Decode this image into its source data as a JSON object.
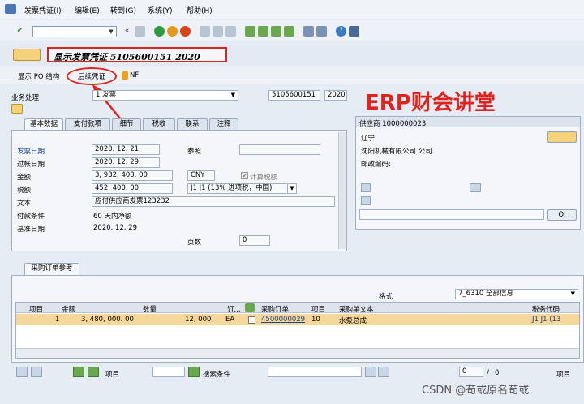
{
  "menu": [
    "发票凭证(I)",
    "编辑(E)",
    "转到(G)",
    "系统(Y)",
    "帮助(H)"
  ],
  "toolbar": {
    "enter_icon": "check-icon",
    "back_icon": "back-icon"
  },
  "title": "显示发票凭证 5105600151 2020",
  "appbar": {
    "po_structure": "显示 PO 结构",
    "follow_on": "后续凭证",
    "nf": "NF"
  },
  "business": {
    "label": "业务处理",
    "value": "1 发票",
    "doc_no": "5105600151",
    "year": "2020"
  },
  "watermark": "ERP财会讲堂",
  "tabs": [
    "基本数据",
    "支付款项",
    "细节",
    "税收",
    "联系",
    "注释"
  ],
  "basic": {
    "invoice_date_label": "发票日期",
    "invoice_date": "2020. 12. 21",
    "posting_date_label": "过帐日期",
    "posting_date": "2020. 12. 29",
    "amount_label": "金额",
    "amount": "3, 932, 400. 00",
    "currency": "CNY",
    "calc_tax": "计算税额",
    "tax_label": "税额",
    "tax": "452, 400. 00",
    "tax_code": "J1 J1 (13% 进项税，中国)",
    "text_label": "文本",
    "text": "应付供应商发票123232",
    "terms_label": "付款条件",
    "terms": "60 天内净额",
    "base_date_label": "基准日期",
    "base_date": "2020. 12. 29",
    "ref_label": "参照",
    "pages_label": "页数",
    "pages": "0"
  },
  "vendor": {
    "header": "供应商 1000000023",
    "region": "辽宁",
    "name": "沈阳机械有限公司 公司",
    "postal_label": "邮政编码:",
    "oi_button": "OI"
  },
  "po_ref": {
    "tab": "采购订单参考",
    "layout_label": "格式",
    "layout_value": "7_6310 全部信息",
    "columns": [
      "项目",
      "金额",
      "数量",
      "订...",
      "",
      "采购订单",
      "项目",
      "采购单文本",
      "税务代码"
    ],
    "row": {
      "item": "1",
      "amount": "3, 480, 000. 00",
      "qty": "12, 000",
      "unit": "EA",
      "po": "4500000029",
      "po_item": "10",
      "text": "水泵总成",
      "tax": "J1  J1 (13"
    }
  },
  "footer": {
    "item_label": "项目",
    "search_label": "搜索条件",
    "page": "0",
    "of": "/",
    "total": "0",
    "item_right": "项目"
  },
  "csdn": "CSDN @苟或原名苟或"
}
